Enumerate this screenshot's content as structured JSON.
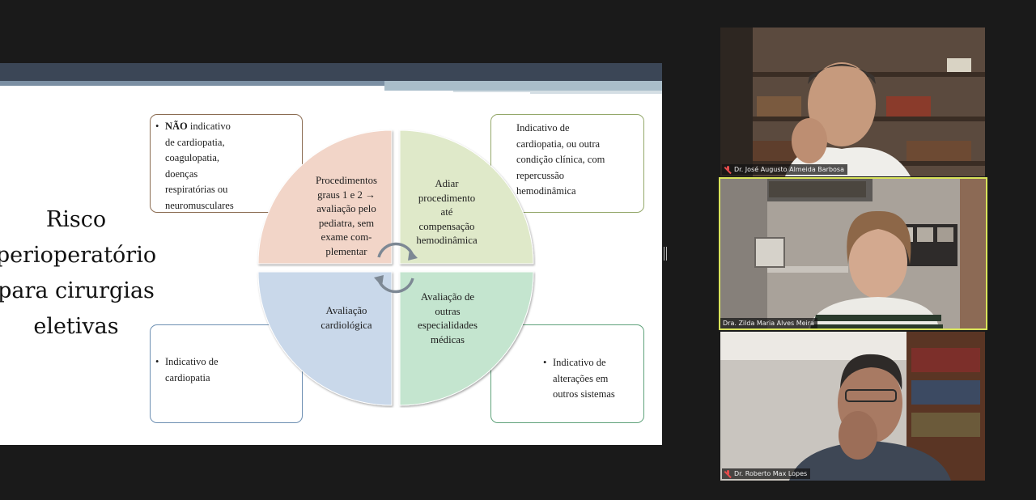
{
  "slide": {
    "title_lines": [
      "Risco",
      "perioperatório",
      "para cirurgias",
      "eletivas"
    ],
    "box_tl": {
      "bold": "NÃO",
      "rest_first": " indicativo",
      "lines": [
        "de cardiopatia,",
        "coagulopatia,",
        "doenças",
        "respiratórias ou",
        "neuromusculares"
      ]
    },
    "box_tr": {
      "lines": [
        "Indicativo de",
        "cardiopatia, ou outra",
        "condição clínica, com",
        "repercussão",
        "hemodinâmica"
      ]
    },
    "box_bl": {
      "lines": [
        "Indicativo de",
        "cardiopatia"
      ]
    },
    "box_br": {
      "lines": [
        "Indicativo de",
        "alterações em",
        "outros sistemas"
      ]
    },
    "quadrants": {
      "tl": [
        "Procedimentos",
        "graus 1 e 2 →",
        "avaliação pelo",
        "pediatra, sem",
        "exame com-",
        "plementar"
      ],
      "tr": [
        "Adiar",
        "procedimento",
        "até",
        "compensação",
        "hemodinâmica"
      ],
      "bl": [
        "Avaliação",
        "cardiológica"
      ],
      "br": [
        "Avaliação de",
        "outras",
        "especialidades",
        "médicas"
      ]
    },
    "colors": {
      "tl": "#f2d5c8",
      "tr": "#dfe9c9",
      "bl": "#c9d8ea",
      "br": "#c4e5cf"
    }
  },
  "participants": [
    {
      "name": "Dr. José Augusto Almeida Barbosa",
      "muted": true,
      "active": false
    },
    {
      "name": "Dra. Zilda Maria Alves Meira",
      "muted": false,
      "active": true
    },
    {
      "name": "Dr. Roberto Max Lopes",
      "muted": true,
      "active": false
    }
  ],
  "icons": {
    "mic": "mic-muted-icon",
    "cycle": "refresh-cycle-icon"
  }
}
